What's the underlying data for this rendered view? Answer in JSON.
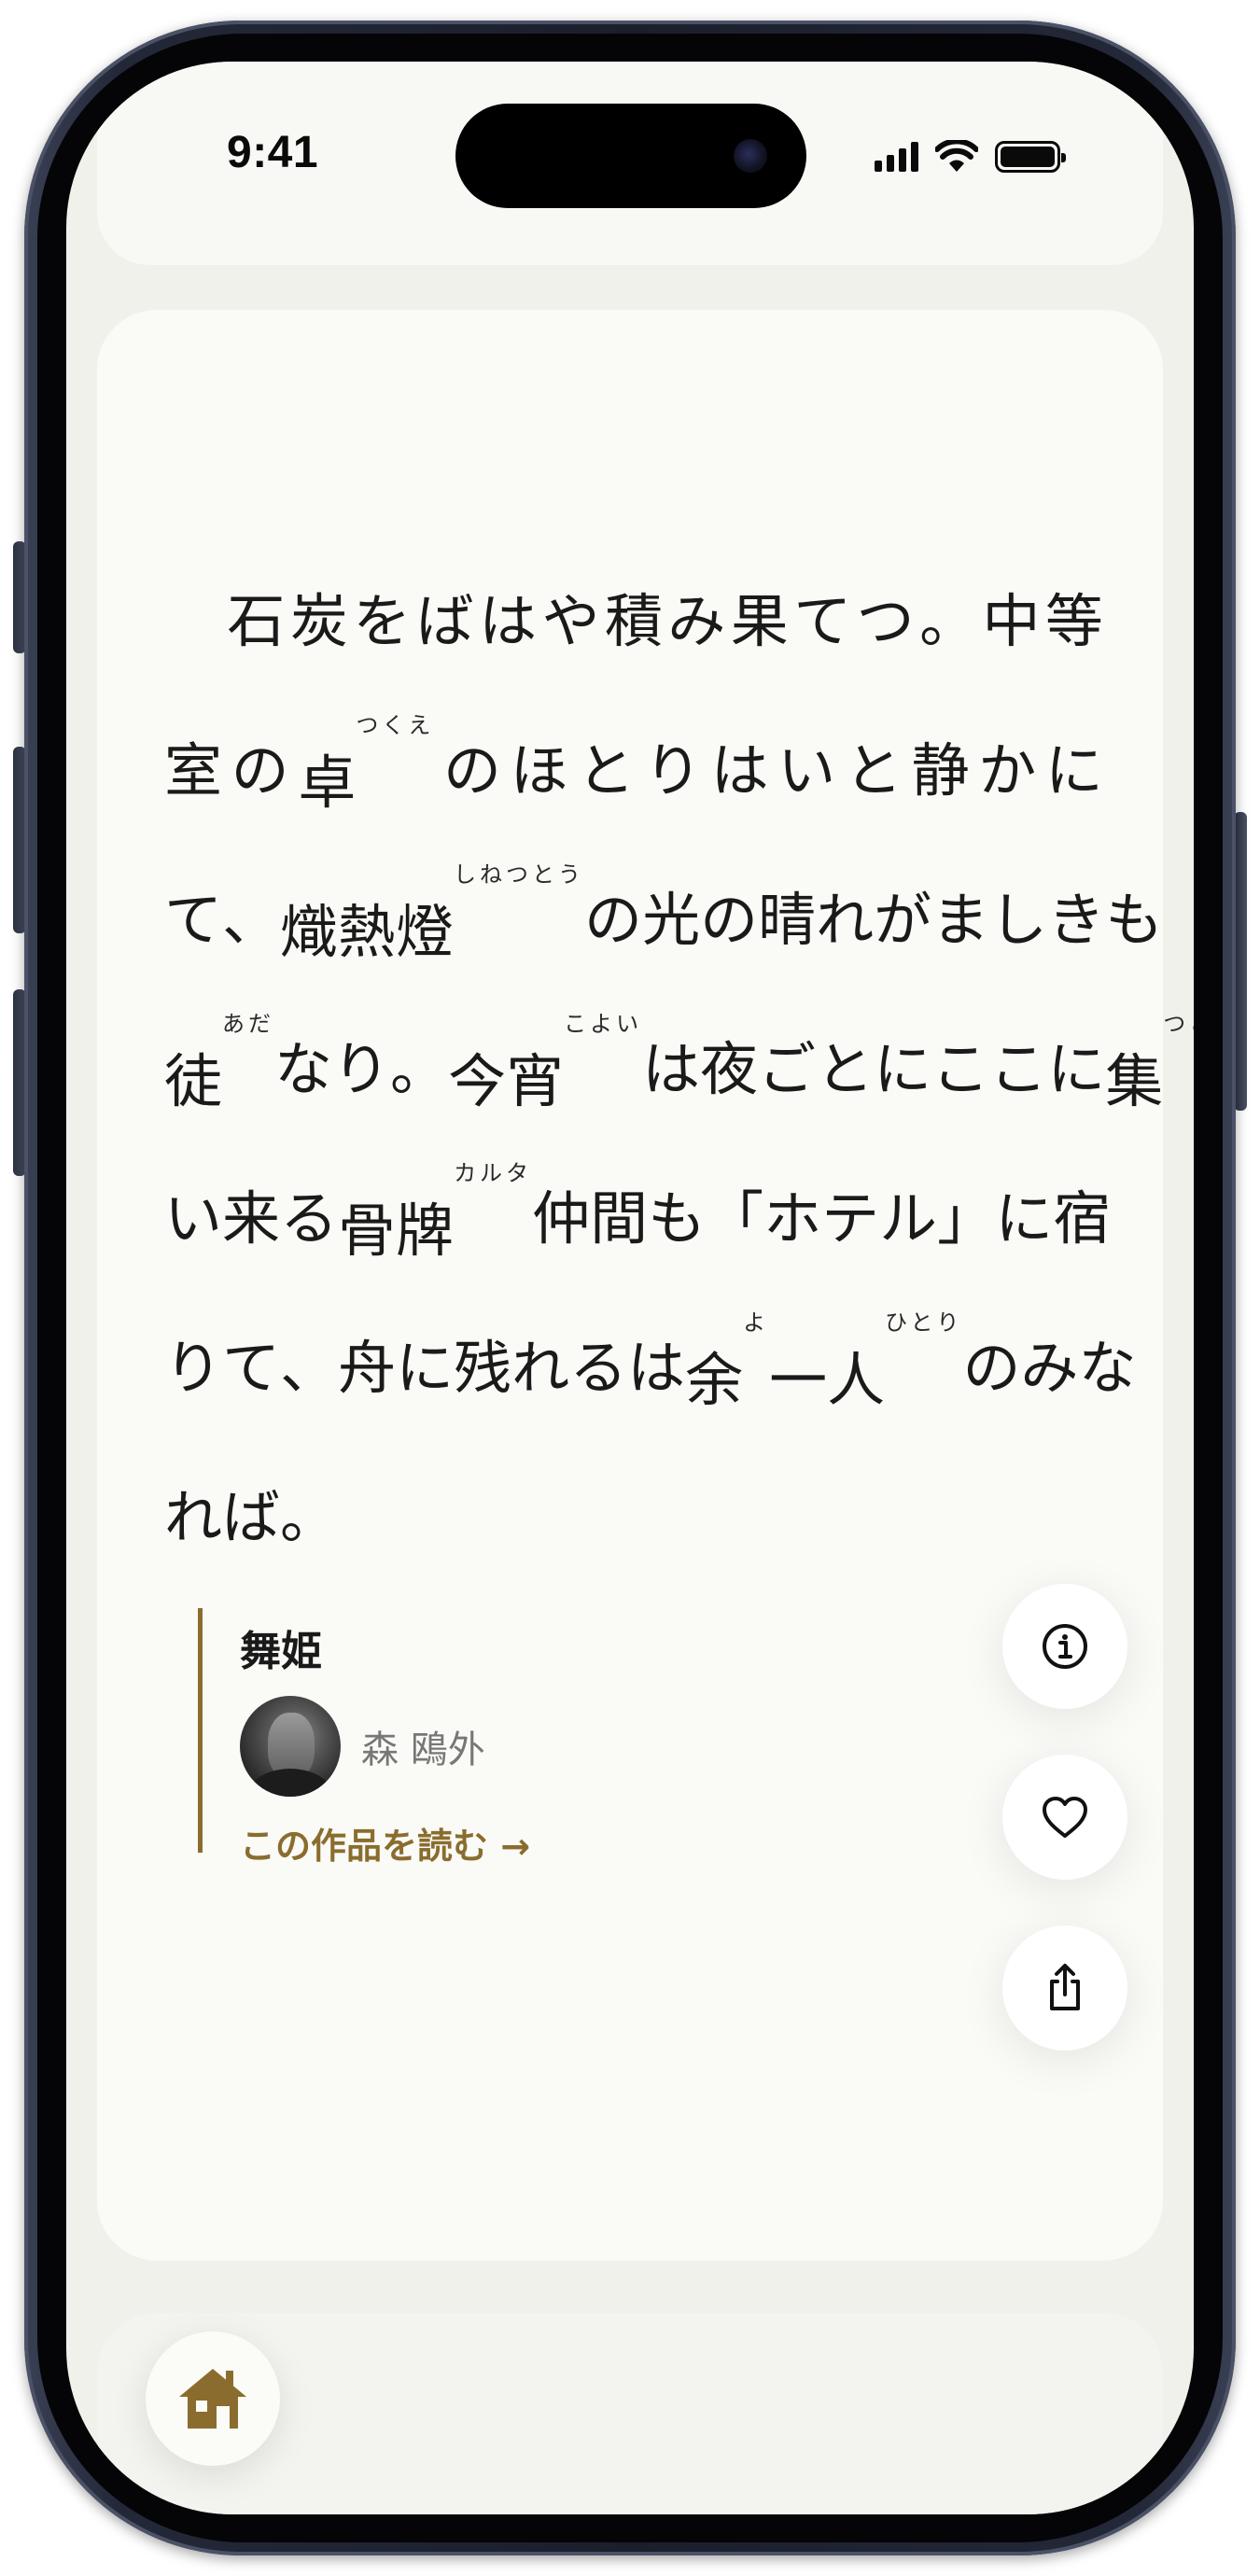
{
  "status_bar": {
    "time": "9:41"
  },
  "passage": {
    "lines": [
      [
        {
          "t": "　"
        },
        {
          "t": "石"
        },
        {
          "t": "炭"
        },
        {
          "t": "を"
        },
        {
          "t": "ば"
        },
        {
          "t": "は"
        },
        {
          "t": "や"
        },
        {
          "t": "積"
        },
        {
          "t": "み"
        },
        {
          "t": "果"
        },
        {
          "t": "て"
        },
        {
          "t": "つ"
        },
        {
          "t": "。"
        },
        {
          "t": "中"
        },
        {
          "t": "等"
        }
      ],
      [
        {
          "t": "室"
        },
        {
          "t": "の"
        },
        {
          "t": "卓",
          "r": "つくえ"
        },
        {
          "t": "の"
        },
        {
          "t": "ほ"
        },
        {
          "t": "と"
        },
        {
          "t": "り"
        },
        {
          "t": "は"
        },
        {
          "t": "い"
        },
        {
          "t": "と"
        },
        {
          "t": "静"
        },
        {
          "t": "か"
        },
        {
          "t": "に"
        }
      ],
      [
        {
          "t": "て"
        },
        {
          "t": "、"
        },
        {
          "t": "熾熱燈",
          "r": "しねつとう"
        },
        {
          "t": "の"
        },
        {
          "t": "光"
        },
        {
          "t": "の"
        },
        {
          "t": "晴"
        },
        {
          "t": "れ"
        },
        {
          "t": "が"
        },
        {
          "t": "ま"
        },
        {
          "t": "し"
        },
        {
          "t": "き"
        },
        {
          "t": "も"
        }
      ],
      [
        {
          "t": "徒",
          "r": "あだ"
        },
        {
          "t": "な"
        },
        {
          "t": "り"
        },
        {
          "t": "。"
        },
        {
          "t": "今宵",
          "r": "こよい"
        },
        {
          "t": "は"
        },
        {
          "t": "夜"
        },
        {
          "t": "ご"
        },
        {
          "t": "と"
        },
        {
          "t": "に"
        },
        {
          "t": "こ"
        },
        {
          "t": "こ"
        },
        {
          "t": "に"
        },
        {
          "t": "集",
          "r": "つど"
        }
      ],
      [
        {
          "t": "い"
        },
        {
          "t": "来"
        },
        {
          "t": "る"
        },
        {
          "t": "骨牌",
          "r": "カルタ"
        },
        {
          "t": "仲"
        },
        {
          "t": "間"
        },
        {
          "t": "も"
        },
        {
          "t": "「"
        },
        {
          "t": "ホ"
        },
        {
          "t": "テ"
        },
        {
          "t": "ル"
        },
        {
          "t": "」"
        },
        {
          "t": "に"
        },
        {
          "t": "宿"
        }
      ],
      [
        {
          "t": "り"
        },
        {
          "t": "て"
        },
        {
          "t": "、"
        },
        {
          "t": "舟"
        },
        {
          "t": "に"
        },
        {
          "t": "残"
        },
        {
          "t": "れ"
        },
        {
          "t": "る"
        },
        {
          "t": "は"
        },
        {
          "t": "余",
          "r": "よ"
        },
        {
          "t": "一人",
          "r": "ひとり"
        },
        {
          "t": "の"
        },
        {
          "t": "み"
        },
        {
          "t": "な"
        }
      ],
      [
        {
          "t": "れ"
        },
        {
          "t": "ば"
        },
        {
          "t": "。"
        }
      ]
    ]
  },
  "work": {
    "title": "舞姫",
    "author": "森 鴎外",
    "read_link": "この作品を読む →"
  },
  "actions": {
    "info_icon": "info-icon",
    "like_icon": "heart-icon",
    "share_icon": "share-icon"
  },
  "nav": {
    "home_icon": "home-icon"
  },
  "colors": {
    "accent": "#8a6d2e",
    "background": "#f1f1ec",
    "card": "#fafaf7",
    "text": "#1a1a1a",
    "muted": "#777777"
  }
}
